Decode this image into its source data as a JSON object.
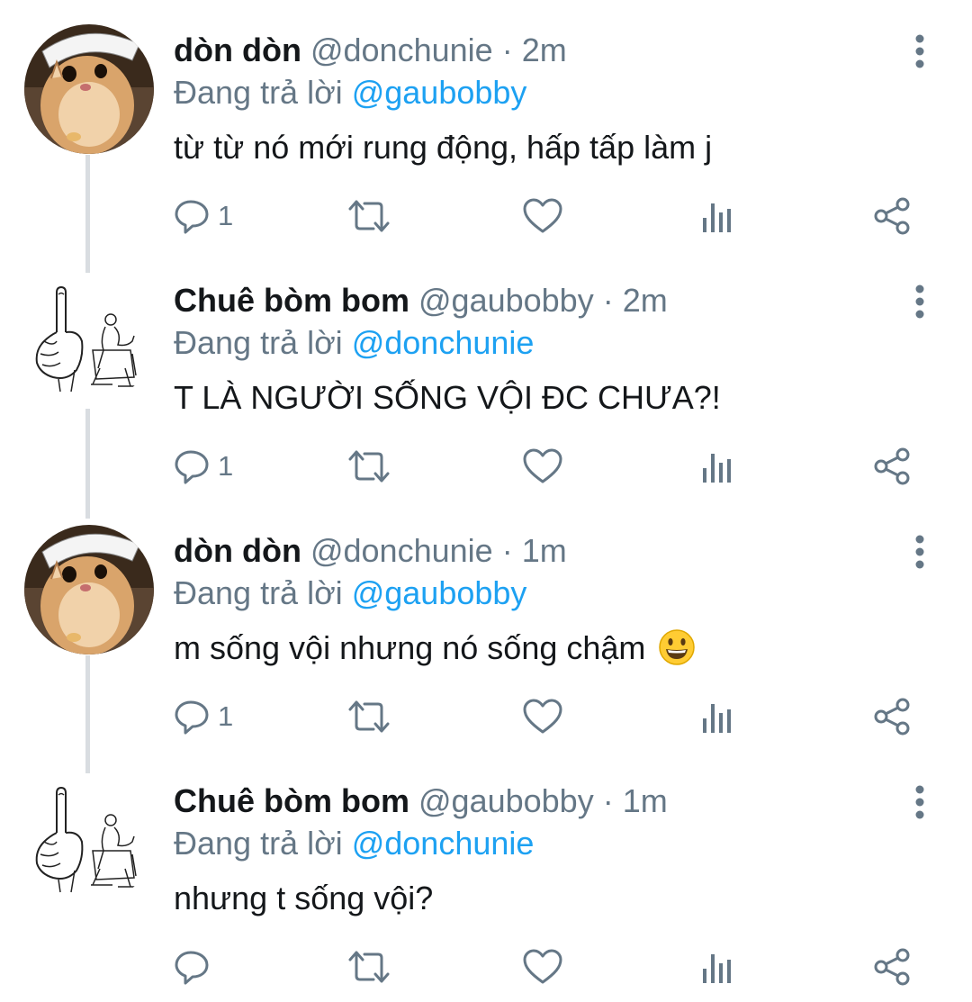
{
  "colors": {
    "text": "#14171a",
    "muted": "#657786",
    "link": "#1da1f2",
    "thread_line": "#d9dde1"
  },
  "tweets": [
    {
      "avatar_icon": "hamster-avatar-icon",
      "name": "dòn dòn",
      "handle": "@donchunie",
      "sep": "·",
      "time": "2m",
      "replying_prefix": "Đang trả lời",
      "replying_to": "@gaubobby",
      "text": "từ từ nó mới rung động, hấp tấp làm j",
      "reply_count": "1"
    },
    {
      "avatar_icon": "sketch-middle-finger-avatar-icon",
      "name": "Chuê bòm bom",
      "handle": "@gaubobby",
      "sep": "·",
      "time": "2m",
      "replying_prefix": "Đang trả lời",
      "replying_to": "@donchunie",
      "text": "T LÀ NGƯỜI SỐNG VỘI ĐC CHƯA?!",
      "reply_count": "1"
    },
    {
      "avatar_icon": "hamster-avatar-icon",
      "name": "dòn dòn",
      "handle": "@donchunie",
      "sep": "·",
      "time": "1m",
      "replying_prefix": "Đang trả lời",
      "replying_to": "@gaubobby",
      "text": "m sống vội nhưng nó sống chậm",
      "emoji_icon": "grinning-face-emoji-icon",
      "reply_count": "1"
    },
    {
      "avatar_icon": "sketch-middle-finger-avatar-icon",
      "name": "Chuê bòm bom",
      "handle": "@gaubobby",
      "sep": "·",
      "time": "1m",
      "replying_prefix": "Đang trả lời",
      "replying_to": "@donchunie",
      "text": "nhưng t sống vội?",
      "reply_count": ""
    }
  ]
}
